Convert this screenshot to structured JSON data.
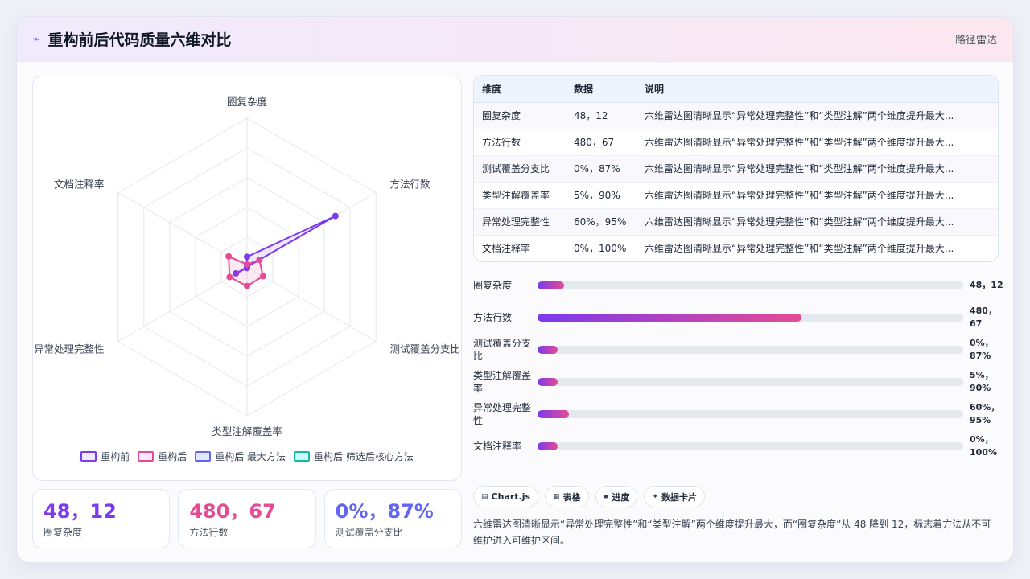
{
  "header": {
    "icon": "sparkle-icon",
    "title": "重构前后代码质量六维对比",
    "badge": "路径雷达"
  },
  "colors": {
    "before": "#7c3aed",
    "after": "#e44b95",
    "after_max": "#6366f1",
    "after_core": "#14b8a6",
    "kpi1": "#7c3aed",
    "kpi2": "#e44b95",
    "kpi3": "#6366f1"
  },
  "chart_data": {
    "type": "radar",
    "categories": [
      "圈复杂度",
      "方法行数",
      "测试覆盖分支比",
      "类型注解覆盖率",
      "异常处理完整性",
      "文档注释率"
    ],
    "series": [
      {
        "name": "重构前",
        "values": [
          48,
          480,
          0,
          5,
          60,
          0
        ]
      },
      {
        "name": "重构后",
        "values": [
          12,
          67,
          87,
          90,
          95,
          100
        ]
      },
      {
        "name": "重构后 最大方法",
        "values": []
      },
      {
        "name": "重构后 筛选后核心方法",
        "values": []
      }
    ],
    "rlim": [
      0,
      700
    ],
    "grid": true,
    "legend_position": "bottom"
  },
  "table": {
    "headers": [
      "维度",
      "数据",
      "说明"
    ],
    "rows": [
      [
        "圈复杂度",
        "48，12",
        "六维雷达图清晰显示“异常处理完整性”和“类型注解”两个维度提升最大..."
      ],
      [
        "方法行数",
        "480，67",
        "六维雷达图清晰显示“异常处理完整性”和“类型注解”两个维度提升最大..."
      ],
      [
        "测试覆盖分支比",
        "0%，87%",
        "六维雷达图清晰显示“异常处理完整性”和“类型注解”两个维度提升最大..."
      ],
      [
        "类型注解覆盖率",
        "5%，90%",
        "六维雷达图清晰显示“异常处理完整性”和“类型注解”两个维度提升最大..."
      ],
      [
        "异常处理完整性",
        "60%，95%",
        "六维雷达图清晰显示“异常处理完整性”和“类型注解”两个维度提升最大..."
      ],
      [
        "文档注释率",
        "0%，100%",
        "六维雷达图清晰显示“异常处理完整性”和“类型注解”两个维度提升最大..."
      ]
    ]
  },
  "bars": [
    {
      "label": "圈复杂度",
      "value": "48，12",
      "fraction": 0.062
    },
    {
      "label": "方法行数",
      "value": "480，67",
      "fraction": 0.62
    },
    {
      "label": "测试覆盖分支比",
      "value": "0%，87%",
      "fraction": 0.048
    },
    {
      "label": "类型注解覆盖率",
      "value": "5%，90%",
      "fraction": 0.048
    },
    {
      "label": "异常处理完整性",
      "value": "60%，95%",
      "fraction": 0.073
    },
    {
      "label": "文档注释率",
      "value": "0%，100%",
      "fraction": 0.048
    }
  ],
  "kpis": [
    {
      "value": "48，12",
      "label": "圈复杂度"
    },
    {
      "value": "480，67",
      "label": "方法行数"
    },
    {
      "value": "0%，87%",
      "label": "测试覆盖分支比"
    }
  ],
  "tags": [
    {
      "icon": "chart-icon",
      "label": "Chart.js"
    },
    {
      "icon": "table-icon",
      "label": "表格"
    },
    {
      "icon": "progress-icon",
      "label": "进度"
    },
    {
      "icon": "card-icon",
      "label": "数据卡片"
    }
  ],
  "note": "六维雷达图清晰显示“异常处理完整性”和“类型注解”两个维度提升最大，而“圈复杂度”从 48 降到 12，标志着方法从不可维护进入可维护区间。"
}
